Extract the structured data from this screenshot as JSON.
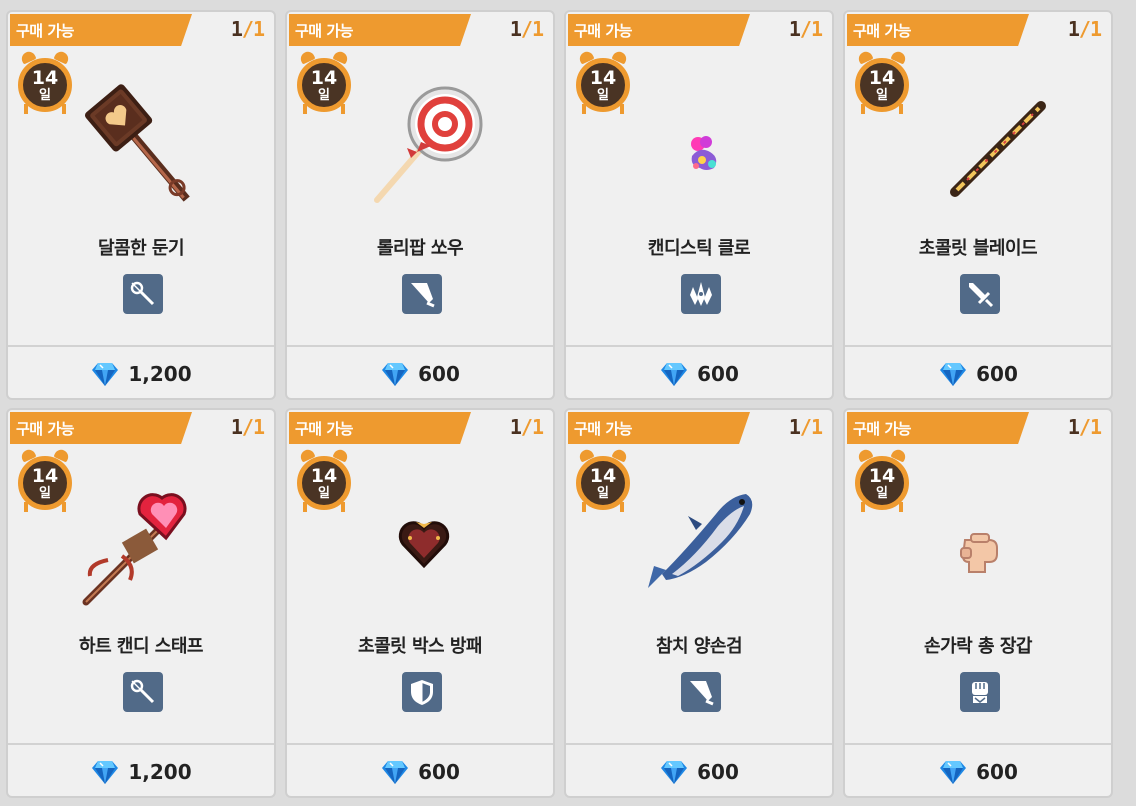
{
  "colors": {
    "accent": "#ee9a2f",
    "stock_current": "#4a3120",
    "type_badge": "#516a88",
    "gem": "#2196f3"
  },
  "shop": {
    "items": [
      {
        "badge": "구매 가능",
        "stock_current": "1",
        "stock_slash": "/",
        "stock_max": "1",
        "days": "14",
        "days_unit": "일",
        "name": "달콤한 둔기",
        "type_icon": "wand-icon",
        "art": "chocolate-mace",
        "currency_icon": "diamond-icon",
        "price": "1,200"
      },
      {
        "badge": "구매 가능",
        "stock_current": "1",
        "stock_slash": "/",
        "stock_max": "1",
        "days": "14",
        "days_unit": "일",
        "name": "롤리팝 쏘우",
        "type_icon": "greatsword-icon",
        "art": "lollipop",
        "currency_icon": "diamond-icon",
        "price": "600"
      },
      {
        "badge": "구매 가능",
        "stock_current": "1",
        "stock_slash": "/",
        "stock_max": "1",
        "days": "14",
        "days_unit": "일",
        "name": "캔디스틱 클로",
        "type_icon": "claw-icon",
        "art": "candy-claw",
        "currency_icon": "diamond-icon",
        "price": "600"
      },
      {
        "badge": "구매 가능",
        "stock_current": "1",
        "stock_slash": "/",
        "stock_max": "1",
        "days": "14",
        "days_unit": "일",
        "name": "초콜릿 블레이드",
        "type_icon": "sword-icon",
        "art": "choco-blade",
        "currency_icon": "diamond-icon",
        "price": "600"
      },
      {
        "badge": "구매 가능",
        "stock_current": "1",
        "stock_slash": "/",
        "stock_max": "1",
        "days": "14",
        "days_unit": "일",
        "name": "하트 캔디 스태프",
        "type_icon": "wand-icon",
        "art": "heart-staff",
        "currency_icon": "diamond-icon",
        "price": "1,200"
      },
      {
        "badge": "구매 가능",
        "stock_current": "1",
        "stock_slash": "/",
        "stock_max": "1",
        "days": "14",
        "days_unit": "일",
        "name": "초콜릿 박스 방패",
        "type_icon": "shield-icon",
        "art": "choco-shield",
        "currency_icon": "diamond-icon",
        "price": "600"
      },
      {
        "badge": "구매 가능",
        "stock_current": "1",
        "stock_slash": "/",
        "stock_max": "1",
        "days": "14",
        "days_unit": "일",
        "name": "참치 양손검",
        "type_icon": "greatsword-icon",
        "art": "tuna",
        "currency_icon": "diamond-icon",
        "price": "600"
      },
      {
        "badge": "구매 가능",
        "stock_current": "1",
        "stock_slash": "/",
        "stock_max": "1",
        "days": "14",
        "days_unit": "일",
        "name": "손가락 총 장갑",
        "type_icon": "gauntlet-icon",
        "art": "finger-gun",
        "currency_icon": "diamond-icon",
        "price": "600"
      }
    ]
  }
}
